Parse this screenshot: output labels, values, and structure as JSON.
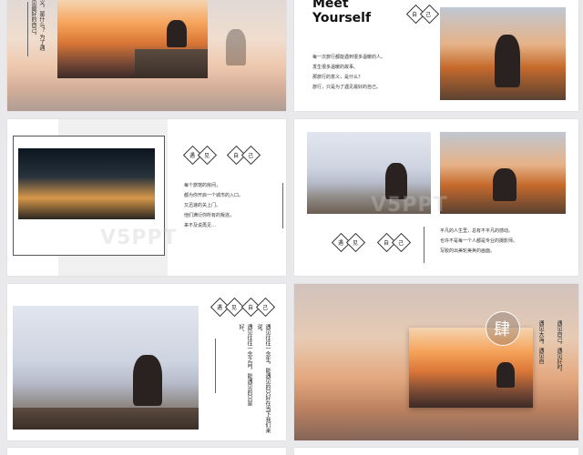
{
  "slide1": {
    "vertical_text": "义，是什么？ 为了遇见最好的自己。"
  },
  "slide2": {
    "title_line1": "Meet",
    "title_line2": "Yourself",
    "badge": [
      "自",
      "己"
    ],
    "paragraph": [
      "每一次旅行都能遇到很多温暖的人。",
      "发生很多温暖的故事。",
      "那旅行的意义，是什么？",
      "旅行，只是为了遇见最好的自己。"
    ]
  },
  "slide3": {
    "badges": [
      "遇",
      "见",
      "自",
      "己"
    ],
    "paragraph": [
      "每个旅馆的房间，",
      "都为你开启一个城市的入口。",
      "又迅速的关上门。",
      "他们满衍你所有的叛逃，",
      "来不及说再见…"
    ],
    "watermark": "V5PPT"
  },
  "slide4": {
    "badges": [
      "遇",
      "见",
      "自",
      "己"
    ],
    "paragraph": [
      "平凡的人生里，总有不平凡的感动。",
      "也许不是每一个人都是专业的摄影师。",
      "写胶的出美轮美奂的画面。"
    ],
    "watermark": "V5PPT"
  },
  "slide5": {
    "badges": [
      "遇",
      "见",
      "自",
      "己"
    ],
    "vertical_col1": "遇见往往一念之间，能遇见的只是好。",
    "vertical_col2": "遇见往往一念生，能遇见的只好在当下我们来说，"
  },
  "slide6": {
    "circle_char": "肆",
    "vertical_left": "遇见大海，遇见自",
    "vertical_right": "遇见自己，遇见好时。"
  }
}
